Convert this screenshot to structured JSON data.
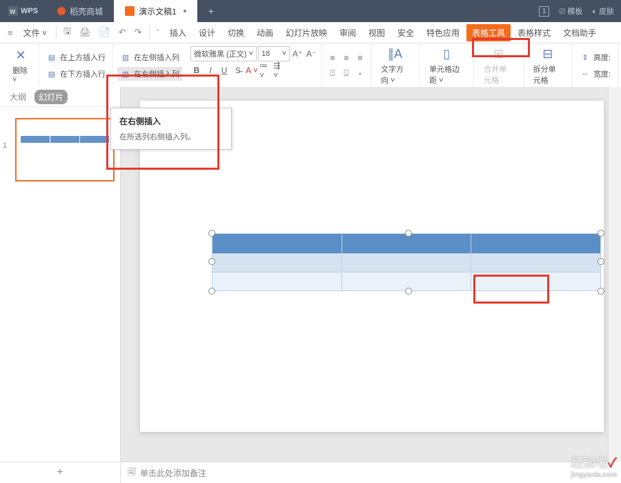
{
  "title_bar": {
    "logo": "WPS",
    "tabs": [
      {
        "label": "稻壳商城",
        "icon": "flame-icon"
      },
      {
        "label": "演示文稿1",
        "icon": "slide-icon",
        "active": true
      }
    ],
    "right": {
      "indicator": "1",
      "templates": "模板",
      "skin": "皮肤"
    }
  },
  "menu": {
    "file": "文件",
    "items": [
      "插入",
      "设计",
      "切换",
      "动画",
      "幻灯片放映",
      "审阅",
      "视图",
      "安全",
      "特色应用",
      "表格工具",
      "表格样式",
      "文档助手"
    ]
  },
  "ribbon": {
    "delete": "删除",
    "insert_row_above": "在上方插入行",
    "insert_row_below": "在下方插入行",
    "insert_col_left": "在左侧插入列",
    "insert_col_right": "在右侧插入列",
    "font_name": "微软雅黑 (正文)",
    "font_size": "18",
    "text_direction": "文字方向",
    "cell_margin": "单元格边距",
    "merge_cells": "合并单元格",
    "split_cells": "拆分单元格",
    "height": "高度:",
    "width": "宽度:"
  },
  "tooltip": {
    "title": "在右侧插入",
    "body": "在所选列右侧插入列。"
  },
  "side": {
    "outline": "大纲",
    "slides": "幻灯片",
    "num": "1"
  },
  "footer": {
    "notes_placeholder": "单击此处添加备注"
  },
  "watermark": {
    "main": "经验啦",
    "sub": "jingyanla.com"
  }
}
